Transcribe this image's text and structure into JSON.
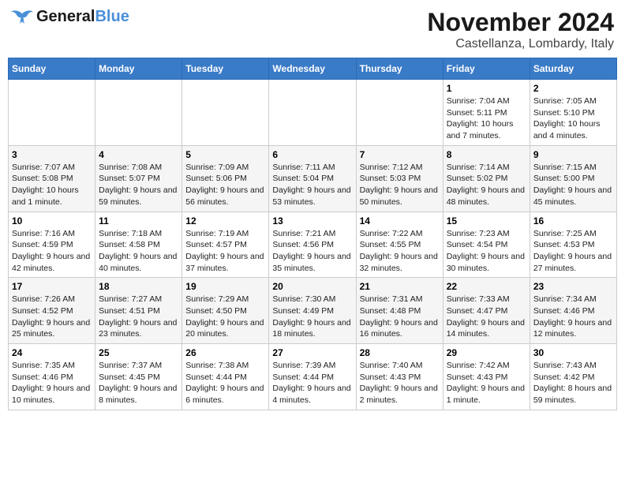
{
  "header": {
    "logo_general": "General",
    "logo_blue": "Blue",
    "month": "November 2024",
    "location": "Castellanza, Lombardy, Italy"
  },
  "weekdays": [
    "Sunday",
    "Monday",
    "Tuesday",
    "Wednesday",
    "Thursday",
    "Friday",
    "Saturday"
  ],
  "weeks": [
    [
      {
        "day": "",
        "info": ""
      },
      {
        "day": "",
        "info": ""
      },
      {
        "day": "",
        "info": ""
      },
      {
        "day": "",
        "info": ""
      },
      {
        "day": "",
        "info": ""
      },
      {
        "day": "1",
        "info": "Sunrise: 7:04 AM\nSunset: 5:11 PM\nDaylight: 10 hours and 7 minutes."
      },
      {
        "day": "2",
        "info": "Sunrise: 7:05 AM\nSunset: 5:10 PM\nDaylight: 10 hours and 4 minutes."
      }
    ],
    [
      {
        "day": "3",
        "info": "Sunrise: 7:07 AM\nSunset: 5:08 PM\nDaylight: 10 hours and 1 minute."
      },
      {
        "day": "4",
        "info": "Sunrise: 7:08 AM\nSunset: 5:07 PM\nDaylight: 9 hours and 59 minutes."
      },
      {
        "day": "5",
        "info": "Sunrise: 7:09 AM\nSunset: 5:06 PM\nDaylight: 9 hours and 56 minutes."
      },
      {
        "day": "6",
        "info": "Sunrise: 7:11 AM\nSunset: 5:04 PM\nDaylight: 9 hours and 53 minutes."
      },
      {
        "day": "7",
        "info": "Sunrise: 7:12 AM\nSunset: 5:03 PM\nDaylight: 9 hours and 50 minutes."
      },
      {
        "day": "8",
        "info": "Sunrise: 7:14 AM\nSunset: 5:02 PM\nDaylight: 9 hours and 48 minutes."
      },
      {
        "day": "9",
        "info": "Sunrise: 7:15 AM\nSunset: 5:00 PM\nDaylight: 9 hours and 45 minutes."
      }
    ],
    [
      {
        "day": "10",
        "info": "Sunrise: 7:16 AM\nSunset: 4:59 PM\nDaylight: 9 hours and 42 minutes."
      },
      {
        "day": "11",
        "info": "Sunrise: 7:18 AM\nSunset: 4:58 PM\nDaylight: 9 hours and 40 minutes."
      },
      {
        "day": "12",
        "info": "Sunrise: 7:19 AM\nSunset: 4:57 PM\nDaylight: 9 hours and 37 minutes."
      },
      {
        "day": "13",
        "info": "Sunrise: 7:21 AM\nSunset: 4:56 PM\nDaylight: 9 hours and 35 minutes."
      },
      {
        "day": "14",
        "info": "Sunrise: 7:22 AM\nSunset: 4:55 PM\nDaylight: 9 hours and 32 minutes."
      },
      {
        "day": "15",
        "info": "Sunrise: 7:23 AM\nSunset: 4:54 PM\nDaylight: 9 hours and 30 minutes."
      },
      {
        "day": "16",
        "info": "Sunrise: 7:25 AM\nSunset: 4:53 PM\nDaylight: 9 hours and 27 minutes."
      }
    ],
    [
      {
        "day": "17",
        "info": "Sunrise: 7:26 AM\nSunset: 4:52 PM\nDaylight: 9 hours and 25 minutes."
      },
      {
        "day": "18",
        "info": "Sunrise: 7:27 AM\nSunset: 4:51 PM\nDaylight: 9 hours and 23 minutes."
      },
      {
        "day": "19",
        "info": "Sunrise: 7:29 AM\nSunset: 4:50 PM\nDaylight: 9 hours and 20 minutes."
      },
      {
        "day": "20",
        "info": "Sunrise: 7:30 AM\nSunset: 4:49 PM\nDaylight: 9 hours and 18 minutes."
      },
      {
        "day": "21",
        "info": "Sunrise: 7:31 AM\nSunset: 4:48 PM\nDaylight: 9 hours and 16 minutes."
      },
      {
        "day": "22",
        "info": "Sunrise: 7:33 AM\nSunset: 4:47 PM\nDaylight: 9 hours and 14 minutes."
      },
      {
        "day": "23",
        "info": "Sunrise: 7:34 AM\nSunset: 4:46 PM\nDaylight: 9 hours and 12 minutes."
      }
    ],
    [
      {
        "day": "24",
        "info": "Sunrise: 7:35 AM\nSunset: 4:46 PM\nDaylight: 9 hours and 10 minutes."
      },
      {
        "day": "25",
        "info": "Sunrise: 7:37 AM\nSunset: 4:45 PM\nDaylight: 9 hours and 8 minutes."
      },
      {
        "day": "26",
        "info": "Sunrise: 7:38 AM\nSunset: 4:44 PM\nDaylight: 9 hours and 6 minutes."
      },
      {
        "day": "27",
        "info": "Sunrise: 7:39 AM\nSunset: 4:44 PM\nDaylight: 9 hours and 4 minutes."
      },
      {
        "day": "28",
        "info": "Sunrise: 7:40 AM\nSunset: 4:43 PM\nDaylight: 9 hours and 2 minutes."
      },
      {
        "day": "29",
        "info": "Sunrise: 7:42 AM\nSunset: 4:43 PM\nDaylight: 9 hours and 1 minute."
      },
      {
        "day": "30",
        "info": "Sunrise: 7:43 AM\nSunset: 4:42 PM\nDaylight: 8 hours and 59 minutes."
      }
    ]
  ]
}
